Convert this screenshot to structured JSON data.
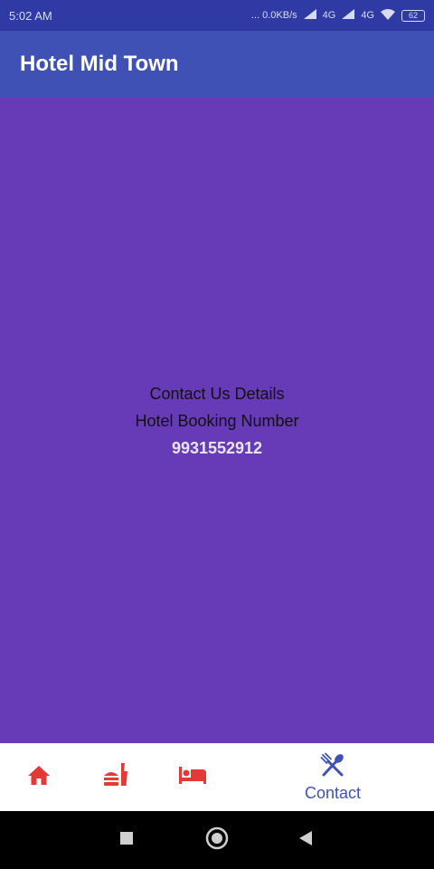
{
  "status_bar": {
    "time": "5:02 AM",
    "indicators": "... 0.0KB/s",
    "network": "4G",
    "battery": "62"
  },
  "app_bar": {
    "title": "Hotel Mid Town"
  },
  "content": {
    "heading": "Contact Us Details",
    "subheading": "Hotel Booking Number",
    "phone": "9931552912"
  },
  "bottom_nav": {
    "items": [
      {
        "icon": "home-icon",
        "label": ""
      },
      {
        "icon": "food-icon",
        "label": ""
      },
      {
        "icon": "bed-icon",
        "label": ""
      },
      {
        "icon": "restaurant-icon",
        "label": "Contact",
        "active": true
      }
    ]
  },
  "colors": {
    "status_bar": "#2f3aa5",
    "app_bar": "#3f51b5",
    "content_bg": "#673ab7",
    "inactive_icon": "#e53935",
    "active_icon": "#3f51b5"
  }
}
